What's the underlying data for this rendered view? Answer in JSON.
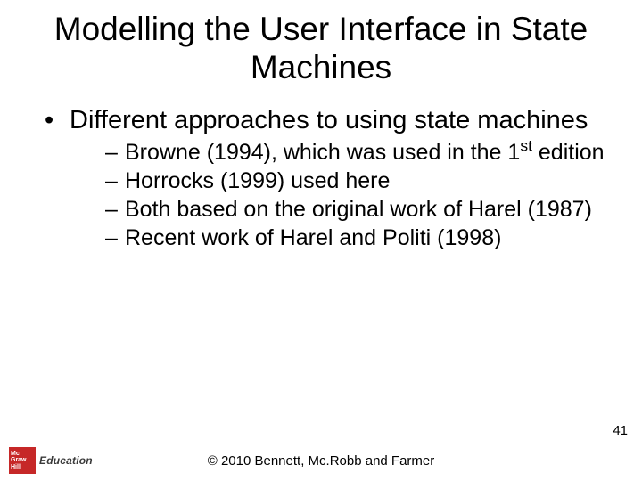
{
  "slide": {
    "title": "Modelling the User Interface in State Machines",
    "bullets": {
      "main": "Different approaches to using state machines",
      "sub1_a": "Browne (1994), which was used in the 1",
      "sub1_sup": "st",
      "sub1_b": " edition",
      "sub2": "Horrocks (1999) used here",
      "sub3": "Both based on the original work of Harel (1987)",
      "sub4": "Recent work of Harel and Politi (1998)"
    },
    "page_number": "41",
    "copyright": "© 2010 Bennett, Mc.Robb and Farmer",
    "logo": {
      "line1": "Mc",
      "line2": "Graw",
      "line3": "Hill",
      "brand": "Education"
    }
  }
}
